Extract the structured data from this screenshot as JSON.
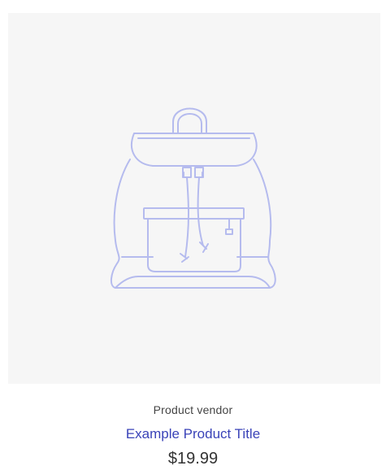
{
  "product": {
    "image_icon": "backpack-illustration",
    "vendor": "Product vendor",
    "title": "Example Product Title",
    "price": "$19.99"
  },
  "colors": {
    "image_background": "#f6f6f6",
    "illustration_stroke": "#b5bbee",
    "title_link": "#3a43b8",
    "price_text": "#333333",
    "vendor_text": "#444444"
  }
}
